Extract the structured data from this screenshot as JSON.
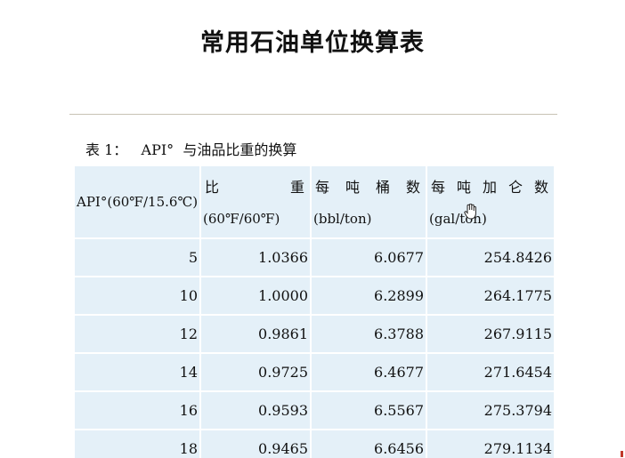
{
  "title": "常用石油单位换算表",
  "caption": "表 1：   API°  与油品比重的换算",
  "table": {
    "headers": {
      "api": "API°(60℉/15.6℃)",
      "sg_top": "比重",
      "sg_bottom": "(60℉/60℉)",
      "bbl_top": "每吨桶数",
      "bbl_bottom": "(bbl/ton)",
      "gal_top": "每吨加仑数",
      "gal_bottom": "(gal/ton)"
    },
    "rows": [
      {
        "api": "5",
        "sg": "1.0366",
        "bbl": "6.0677",
        "gal": "254.8426"
      },
      {
        "api": "10",
        "sg": "1.0000",
        "bbl": "6.2899",
        "gal": "264.1775"
      },
      {
        "api": "12",
        "sg": "0.9861",
        "bbl": "6.3788",
        "gal": "267.9115"
      },
      {
        "api": "14",
        "sg": "0.9725",
        "bbl": "6.4677",
        "gal": "271.6454"
      },
      {
        "api": "16",
        "sg": "0.9593",
        "bbl": "6.5567",
        "gal": "275.3794"
      },
      {
        "api": "18",
        "sg": "0.9465",
        "bbl": "6.6456",
        "gal": "279.1134"
      }
    ]
  },
  "cursor_icon": "hand-pointer-icon",
  "colors": {
    "cell_background": "#e4f0f8",
    "rule": "#c8c3b4",
    "edge_mark": "#c0392b"
  }
}
